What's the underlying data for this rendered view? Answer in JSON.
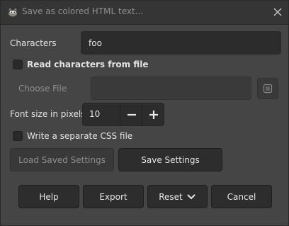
{
  "window": {
    "title": "Save as colored HTML text...",
    "close_icon": "close-icon",
    "app_icon": "gimp-wilber-icon"
  },
  "characters": {
    "label": "Characters",
    "value": "foo"
  },
  "read_from_file": {
    "label": "Read characters from file",
    "checked": false
  },
  "choose_file": {
    "label": "Choose File",
    "value": "",
    "button_icon": "file-browse-icon"
  },
  "font_size": {
    "label": "Font size in pixels",
    "value": "10",
    "decrement_icon": "minus-icon",
    "increment_icon": "plus-icon"
  },
  "separate_css": {
    "label": "Write a separate CSS file",
    "checked": false
  },
  "settings": {
    "load_label": "Load Saved Settings",
    "save_label": "Save Settings"
  },
  "actions": {
    "help_label": "Help",
    "export_label": "Export",
    "reset_label": "Reset",
    "reset_icon": "chevron-down-icon",
    "cancel_label": "Cancel"
  }
}
